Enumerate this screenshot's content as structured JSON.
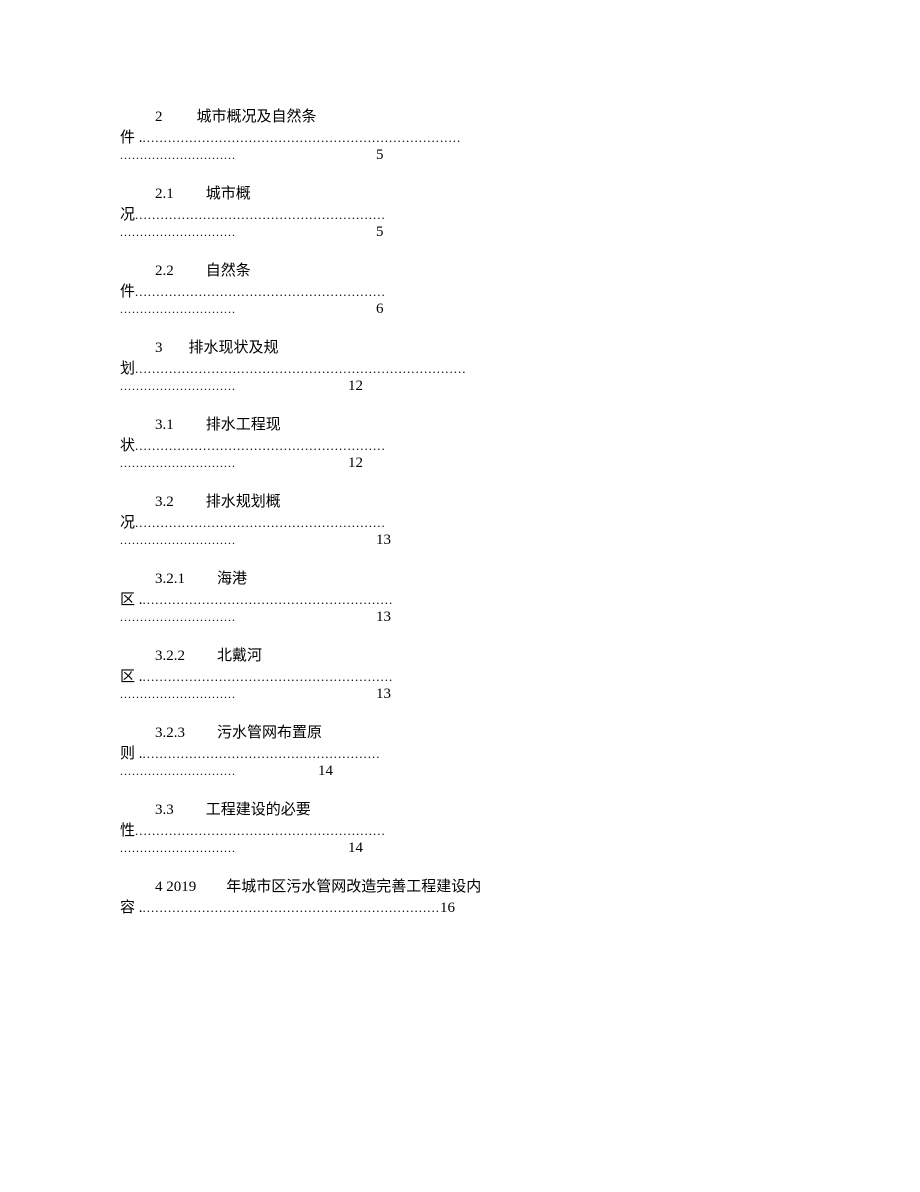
{
  "entries": [
    {
      "num": "2",
      "numGap": "34px",
      "title": "城市概况及自然条",
      "cont": "件 .",
      "dots1": " ...........................................................................",
      "dots2": ".............................",
      "pageGap": "140px",
      "page": "5"
    },
    {
      "num": "2.1",
      "numGap": "32px",
      "title": "城市概",
      "cont": "况",
      "dots1": " ...........................................................",
      "dots2": ".............................",
      "pageGap": "140px",
      "page": "5"
    },
    {
      "num": "2.2",
      "numGap": "32px",
      "title": "自然条",
      "cont": "件",
      "dots1": " ...........................................................",
      "dots2": ".............................",
      "pageGap": "140px",
      "page": "6"
    },
    {
      "num": "3",
      "numGap": "26px",
      "title": "排水现状及规",
      "cont": "划",
      "dots1": "..............................................................................",
      "dots2": ".............................",
      "pageGap": "112px",
      "page": "12"
    },
    {
      "num": "3.1",
      "numGap": "32px",
      "title": "排水工程现",
      "cont": "状",
      "dots1": " ...........................................................",
      "dots2": ".............................",
      "pageGap": "112px",
      "page": "12"
    },
    {
      "num": "3.2",
      "numGap": "32px",
      "title": "排水规划概",
      "cont": "况",
      "dots1": " ...........................................................",
      "dots2": ".............................",
      "pageGap": "140px",
      "page": "13"
    },
    {
      "num": "3.2.1",
      "numGap": "32px",
      "title": "海港",
      "cont": "区 .",
      "dots1": " ...........................................................",
      "dots2": ".............................",
      "pageGap": "140px",
      "page": "13"
    },
    {
      "num": "3.2.2",
      "numGap": "32px",
      "title": "北戴河",
      "cont": "区 .",
      "dots1": " ...........................................................",
      "dots2": ".............................",
      "pageGap": "140px",
      "page": "13"
    },
    {
      "num": "3.2.3",
      "numGap": "32px",
      "title": "污水管网布置原",
      "cont": "则 .",
      "dots1": " ........................................................",
      "dots2": ".............................",
      "pageGap": "82px",
      "page": "14"
    },
    {
      "num": "3.3",
      "numGap": "32px",
      "title": "工程建设的必要",
      "cont": "性",
      "dots1": " ...........................................................",
      "dots2": ".............................",
      "pageGap": "112px",
      "page": "14"
    }
  ],
  "lastEntry": {
    "num": "4 2019",
    "numGap": "30px",
    "title": "年城市区污水管网改造完善工程建设内",
    "cont": "容 . ",
    "dots": "......................................................................",
    "page": " 16"
  }
}
